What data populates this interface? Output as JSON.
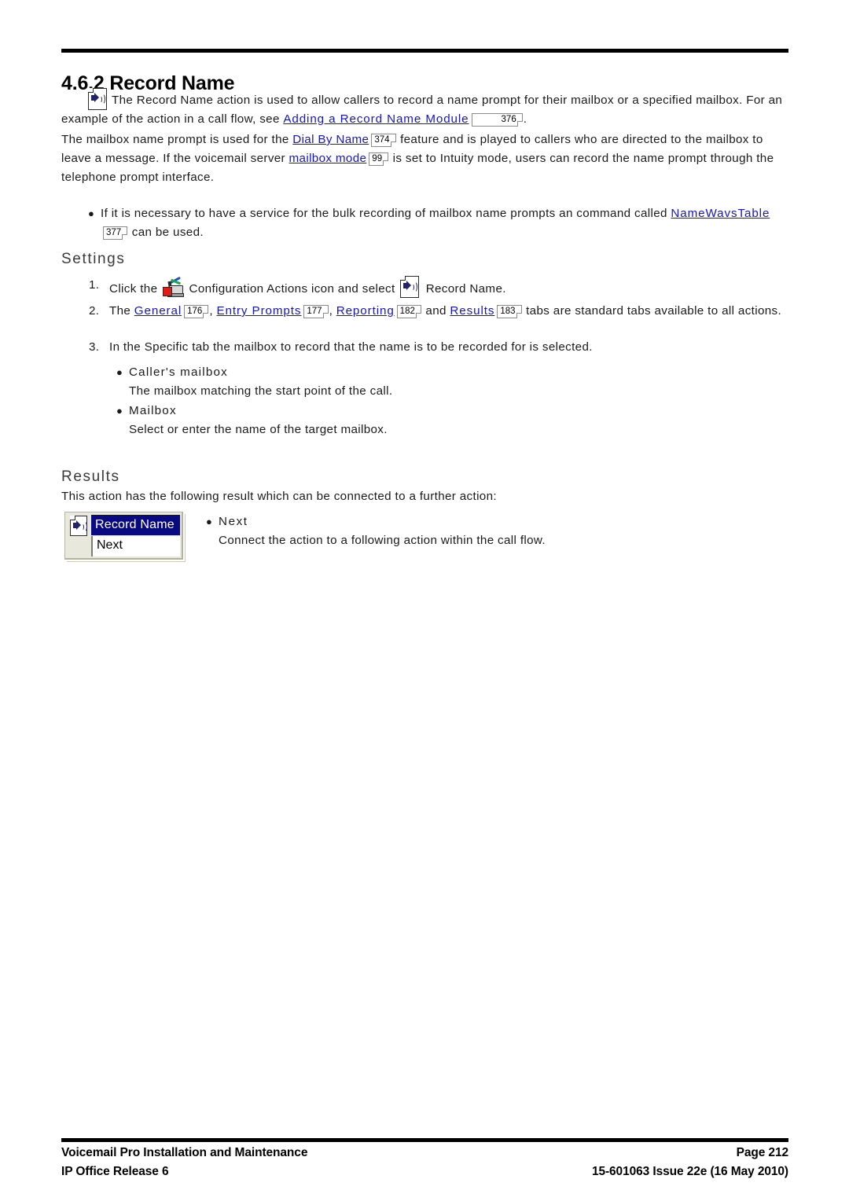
{
  "document": {
    "heading": "4.6.2 Record Name",
    "intro": {
      "icon": "record-name-icon",
      "text_before_link": "The Record Name action is used to allow callers to record a name prompt for their mailbox or a specified mailbox. For an example of the action in a call flow, see ",
      "link": "Adding a Record Name Module",
      "link_ref": "376",
      "text_after_link": "."
    },
    "paragraph2": {
      "part1": "The mailbox name prompt is used for the ",
      "link1": "Dial By Name",
      "link1_ref": "374",
      "part2": " feature and is played to callers who are directed to the mailbox to leave a message. If the voicemail server ",
      "link2": "mailbox mode",
      "link2_ref": "99",
      "part3": " is set to Intuity mode, users can record the name prompt through the telephone prompt interface."
    },
    "bullet_namewavs": {
      "part1": "If it is necessary to have a service for the bulk recording of mailbox name prompts an command called ",
      "link": "NameWavsTable",
      "link_ref": "377",
      "part2": " can be used."
    },
    "settings": {
      "heading": "Settings",
      "steps": [
        {
          "number": "1.",
          "part1": "Click the ",
          "icon1": "configuration-actions-icon",
          "part2": " Configuration Actions icon and select ",
          "icon2": "record-name-icon",
          "part3": " Record Name."
        },
        {
          "number": "2.",
          "part1": "The ",
          "links": [
            {
              "label": "General",
              "ref": "176",
              "sep": ", "
            },
            {
              "label": "Entry Prompts",
              "ref": "177",
              "sep": ", "
            },
            {
              "label": "Reporting",
              "ref": "182",
              "sep": " and "
            },
            {
              "label": "Results",
              "ref": "183",
              "sep": " "
            }
          ],
          "part2": "tabs are standard tabs available to all actions."
        },
        {
          "number": "3.",
          "text": "In the Specific tab the mailbox to record that the name is to be recorded for is selected."
        }
      ],
      "sub_bullets": [
        {
          "term": "Caller's mailbox",
          "description": "The mailbox matching the start point of the call."
        },
        {
          "term": "Mailbox",
          "description": "Select or enter the name of the target mailbox."
        }
      ]
    },
    "results": {
      "heading": "Results",
      "intro": "This action has the following result which can be connected to a further action:",
      "widget": {
        "icon": "record-name-icon",
        "title": "Record Name",
        "result": "Next"
      },
      "bullet": {
        "term": "Next",
        "description": "Connect the action to a following action within the call flow."
      }
    }
  },
  "footer": {
    "left_line1": "Voicemail Pro Installation and Maintenance",
    "left_line2": "IP Office Release 6",
    "right_line1": "Page 212",
    "right_line2": "15-601063 Issue 22e (16 May 2010)"
  },
  "colors": {
    "link": "#1414cf",
    "heading_sub": "#3a3a3a",
    "widget_titlebar": "#0a0a80",
    "widget_face": "#e8e8dc"
  }
}
